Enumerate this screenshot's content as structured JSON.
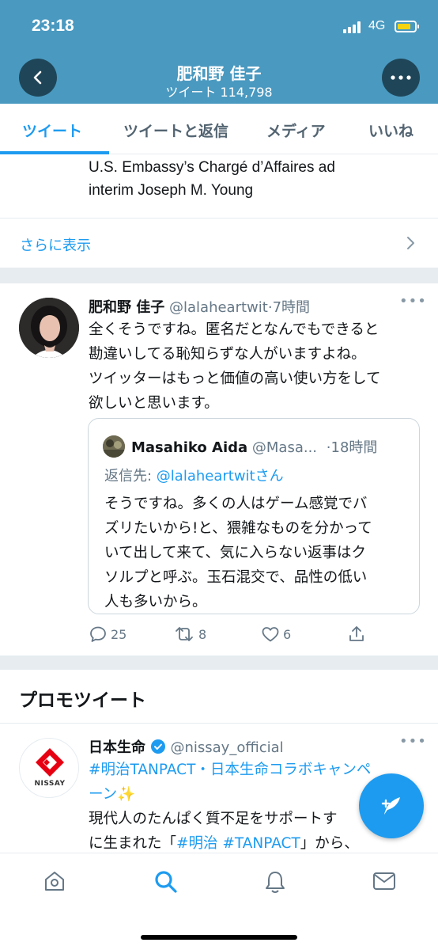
{
  "status_bar": {
    "time": "23:18",
    "network": "4G"
  },
  "header": {
    "name": "肥和野 佳子",
    "tweet_count": "ツイート 114,798"
  },
  "tabs": [
    "ツイート",
    "ツイートと返信",
    "メディア",
    "いいね"
  ],
  "prev_tweet": {
    "line1": "U.S. Embassy’s Chargé d’Affaires ad",
    "line2": "interim Joseph M. Young",
    "show_more": "さらに表示"
  },
  "tweet": {
    "name": "肥和野 佳子",
    "handle": "@lalaheartwit",
    "time": "·7時間",
    "text_lines": [
      "全くそうですね。匿名だとなんでもできると",
      "勘違いしてる恥知らずな人がいますよね。",
      "ツイッターはもっと価値の高い使い方をして",
      "欲しいと思います。"
    ],
    "quote": {
      "name": "Masahiko Aida",
      "handle": "@Masa...",
      "time": "·18時間",
      "reply_prefix": "返信先: ",
      "reply_to": "@lalaheartwitさん",
      "text_lines": [
        "そうですね。多くの人はゲーム感覚でバ",
        "ズリたいから!と、猥雑なものを分かって",
        "いて出して来て、気に入らない返事はク",
        "ソルプと呼ぶ。玉石混交で、品性の低い",
        "人も多いから。"
      ]
    },
    "actions": {
      "replies": "25",
      "retweets": "8",
      "likes": "6"
    }
  },
  "promo": {
    "heading": "プロモツイート",
    "name": "日本生命",
    "handle": "@nissay_official",
    "logo_text": "NISSAY",
    "line1": "#明治TANPACT・日本生命コラボキャンペ",
    "line2_link": "ーン",
    "line2_emoji": "✨",
    "line3": "現代人のたんぱく質不足をサポートす",
    "line4_pre": "に生まれた「",
    "line4_link": "#明治 #TANPACT",
    "line4_post": "」から、"
  },
  "colors": {
    "header_bg": "#4a99c0",
    "accent": "#1d9bf0"
  },
  "icons": [
    "back-arrow-icon",
    "more-dots-icon",
    "chevron-right-icon",
    "reply-icon",
    "retweet-icon",
    "like-icon",
    "share-icon",
    "verified-badge-icon",
    "compose-icon",
    "home-icon",
    "search-icon",
    "notifications-icon",
    "messages-icon"
  ]
}
